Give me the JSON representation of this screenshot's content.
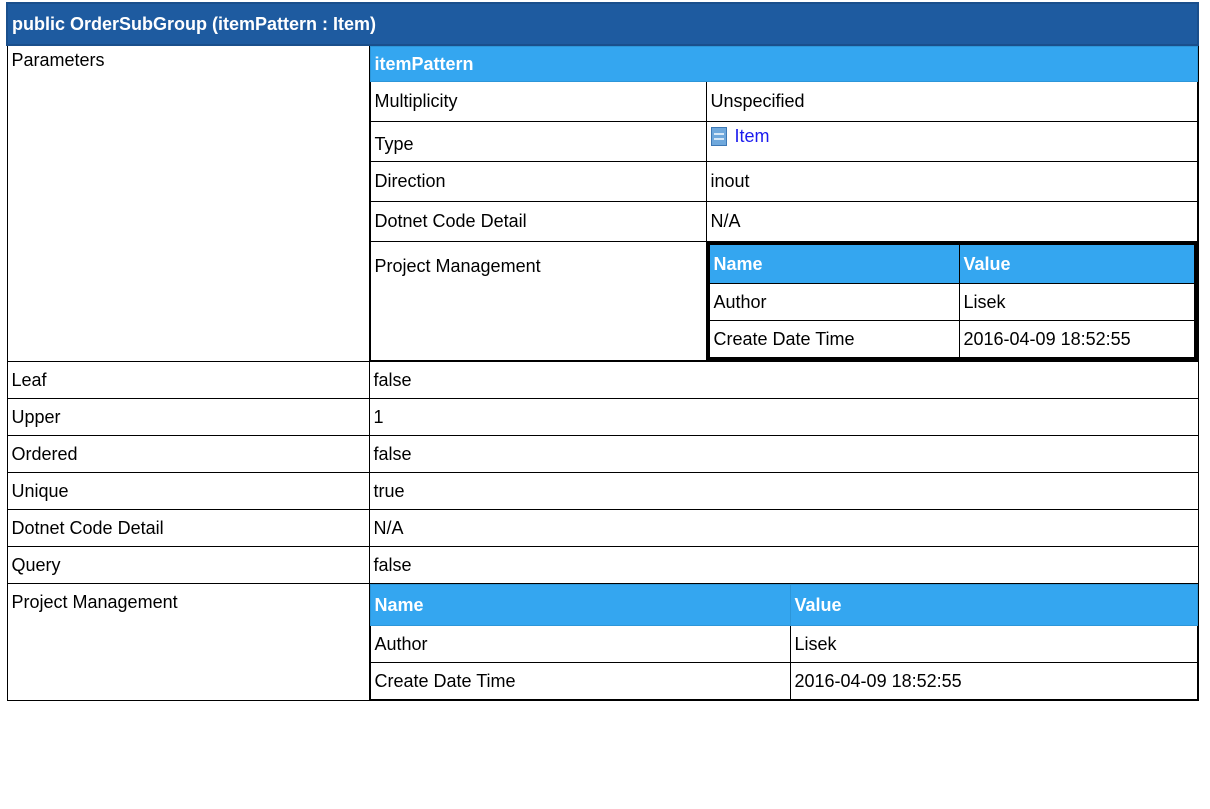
{
  "title": "public OrderSubGroup (itemPattern : Item)",
  "parameters": {
    "label": "Parameters",
    "param_name": "itemPattern",
    "rows": {
      "multiplicity": {
        "label": "Multiplicity",
        "value": "Unspecified"
      },
      "type": {
        "label": "Type",
        "value": "Item",
        "icon": "class-icon"
      },
      "direction": {
        "label": "Direction",
        "value": "inout"
      },
      "dotnet": {
        "label": "Dotnet Code Detail",
        "value": "N/A"
      },
      "project_management": {
        "label": "Project Management",
        "headers": [
          "Name",
          "Value"
        ],
        "rows": [
          {
            "name": "Author",
            "value": "Lisek"
          },
          {
            "name": "Create Date Time",
            "value": "2016-04-09 18:52:55"
          }
        ]
      }
    }
  },
  "properties": [
    {
      "label": "Leaf",
      "value": "false"
    },
    {
      "label": "Upper",
      "value": "1"
    },
    {
      "label": "Ordered",
      "value": "false"
    },
    {
      "label": "Unique",
      "value": "true"
    },
    {
      "label": "Dotnet Code Detail",
      "value": "N/A"
    },
    {
      "label": "Query",
      "value": "false"
    }
  ],
  "project_management": {
    "label": "Project Management",
    "headers": [
      "Name",
      "Value"
    ],
    "rows": [
      {
        "name": "Author",
        "value": "Lisek"
      },
      {
        "name": "Create Date Time",
        "value": "2016-04-09 18:52:55"
      }
    ]
  },
  "colors": {
    "title_bg": "#1e5ba0",
    "header_bg": "#34a6f0",
    "link": "#1a1aee"
  }
}
